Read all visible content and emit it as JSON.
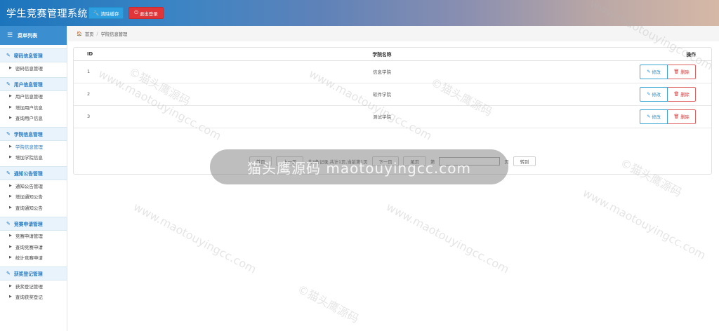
{
  "app": {
    "title": "学生竞赛管理系统",
    "clear_cache_label": "清除缓存",
    "logout_label": "退出登录"
  },
  "sidebar": {
    "menu_title": "菜单列表",
    "groups": [
      {
        "label": "密码信息管理",
        "items": [
          {
            "label": "密码信息管理"
          }
        ]
      },
      {
        "label": "用户信息管理",
        "items": [
          {
            "label": "用户信息管理"
          },
          {
            "label": "增加用户信息"
          },
          {
            "label": "查询用户信息"
          }
        ]
      },
      {
        "label": "学院信息管理",
        "items": [
          {
            "label": "学院信息管理"
          },
          {
            "label": "增加学院信息"
          }
        ]
      },
      {
        "label": "通知公告管理",
        "items": [
          {
            "label": "通知公告管理"
          },
          {
            "label": "增加通知公告"
          },
          {
            "label": "查询通知公告"
          }
        ]
      },
      {
        "label": "竞赛申请管理",
        "items": [
          {
            "label": "竞赛申请管理"
          },
          {
            "label": "查询竞赛申请"
          },
          {
            "label": "统计竞赛申请"
          }
        ]
      },
      {
        "label": "获奖登记管理",
        "items": [
          {
            "label": "获奖登记管理"
          },
          {
            "label": "查询获奖登记"
          }
        ]
      }
    ]
  },
  "breadcrumb": {
    "home": "首页",
    "current": "学院信息管理"
  },
  "table": {
    "headers": {
      "id": "ID",
      "name": "学院名称",
      "op": "操作"
    },
    "rows": [
      {
        "id": "1",
        "name": "信息学院"
      },
      {
        "id": "2",
        "name": "软件学院"
      },
      {
        "id": "3",
        "name": "测试学院"
      }
    ],
    "edit_label": "修改",
    "delete_label": "删除"
  },
  "pager": {
    "first": "首页",
    "prev": "上一页",
    "info": "共3条记录,共计1页,当前第1页",
    "next": "下一页",
    "last": "尾页",
    "page_prefix": "第",
    "page_suffix": "页",
    "go": "转到"
  },
  "watermark": {
    "url": "www.maotouyingcc.com",
    "cn": "©猫头鹰源码",
    "banner": "猫头鹰源码 maotouyingcc.com"
  }
}
